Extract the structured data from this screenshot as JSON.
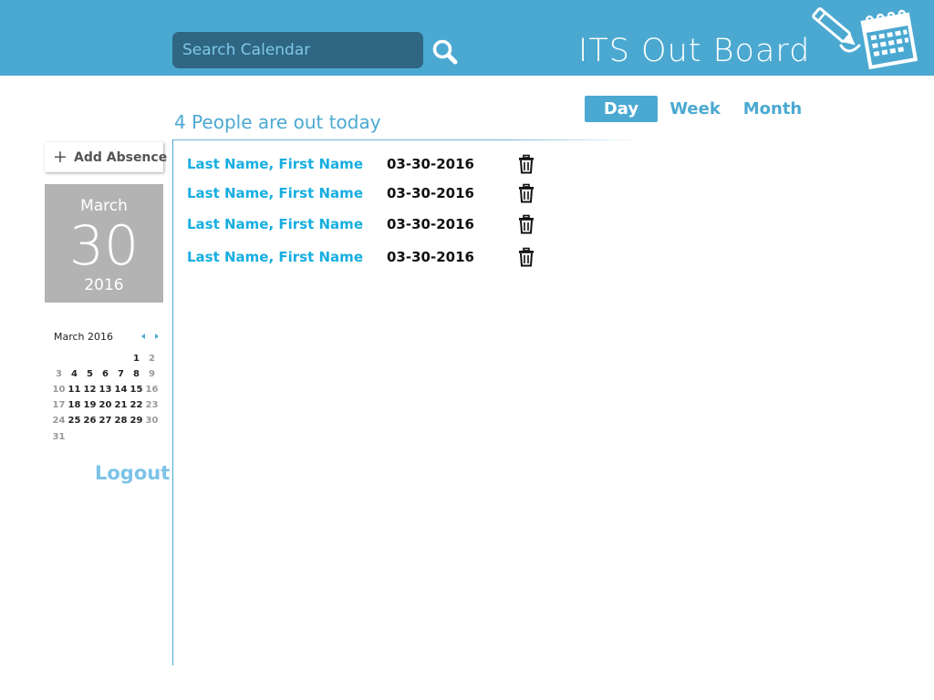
{
  "header": {
    "search_placeholder": "Search Calendar",
    "search_icon": "search-icon",
    "app_title": "ITS Out Board",
    "logo_icon": "calendar-pencil-icon"
  },
  "view_tabs": [
    {
      "label": "Day",
      "active": true
    },
    {
      "label": "Week",
      "active": false
    },
    {
      "label": "Month",
      "active": false
    }
  ],
  "main": {
    "heading": "4 People are out today",
    "absences": [
      {
        "name": "Last Name, First Name",
        "date": "03-30-2016",
        "delete_icon": "trash-icon"
      },
      {
        "name": "Last Name, First Name",
        "date": "03-30-2016",
        "delete_icon": "trash-icon"
      },
      {
        "name": "Last Name, First Name",
        "date": "03-30-2016",
        "delete_icon": "trash-icon"
      },
      {
        "name": "Last Name, First Name",
        "date": "03-30-2016",
        "delete_icon": "trash-icon"
      }
    ]
  },
  "sidebar": {
    "add_absence": {
      "icon": "plus-icon",
      "plus_glyph": "+",
      "label": "Add Absence"
    },
    "date_card": {
      "month": "March",
      "day": "30",
      "year": "2016"
    },
    "mini_calendar": {
      "title": "March 2016",
      "prev_icon": "arrow-left-icon",
      "next_icon": "arrow-right-icon",
      "weeks": [
        [
          "",
          "",
          "",
          "",
          "",
          "1",
          "2"
        ],
        [
          "3",
          "4",
          "5",
          "6",
          "7",
          "8",
          "9"
        ],
        [
          "10",
          "11",
          "12",
          "13",
          "14",
          "15",
          "16"
        ],
        [
          "17",
          "18",
          "19",
          "20",
          "21",
          "22",
          "23"
        ],
        [
          "24",
          "25",
          "26",
          "27",
          "28",
          "29",
          "30"
        ],
        [
          "31",
          "",
          "",
          "",
          "",
          "",
          ""
        ]
      ]
    },
    "logout": "Logout"
  },
  "colors": {
    "header_bg": "#4ba9d1",
    "search_bg": "#2f6682",
    "link": "#17aee0",
    "date_card_bg": "#b3b3b3",
    "logout": "#7cc3e8"
  }
}
